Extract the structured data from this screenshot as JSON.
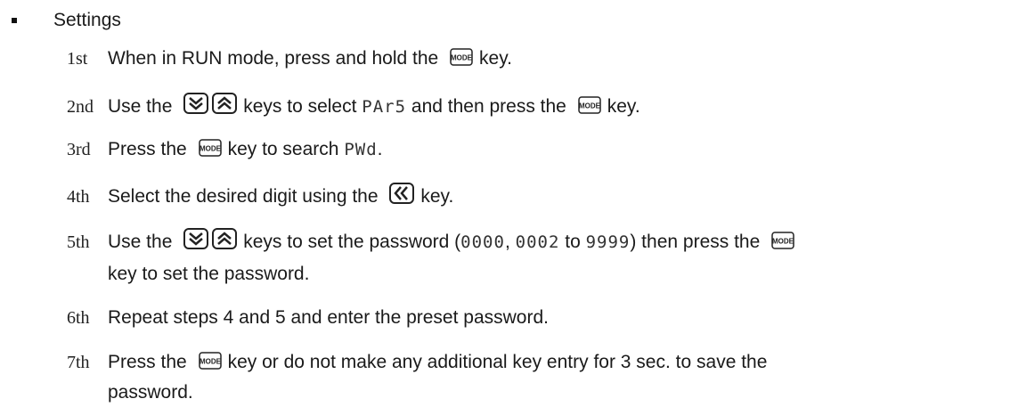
{
  "heading": "Settings",
  "steps": [
    {
      "num": "1st",
      "a": "When in RUN mode, press and hold the",
      "b": "key."
    },
    {
      "num": "2nd",
      "a": "Use the",
      "b": "keys to select",
      "c": "and then press the",
      "d": "key."
    },
    {
      "num": "3rd",
      "a": "Press the",
      "b": "key to search",
      "c": "."
    },
    {
      "num": "4th",
      "a": "Select the desired digit using the",
      "b": "key."
    },
    {
      "num": "5th",
      "a": "Use the",
      "b": "keys to set the password (",
      "c": ",",
      "d": "to",
      "e": ") then press the",
      "cont": "key to set the password."
    },
    {
      "num": "6th",
      "a": "Repeat steps 4 and 5 and enter the preset password."
    },
    {
      "num": "7th",
      "a": "Press the",
      "b": "key or do not make any additional key entry for 3 sec. to save the",
      "cont": "password."
    }
  ],
  "display": {
    "par5": "PAr5",
    "pwd": "PWd",
    "pw_min": "0000",
    "pw_next": "0002",
    "pw_max": "9999"
  },
  "keys": {
    "mode": "MODE"
  },
  "icons": [
    "mode-key-icon",
    "down-key-icon",
    "up-key-icon",
    "shift-key-icon"
  ]
}
